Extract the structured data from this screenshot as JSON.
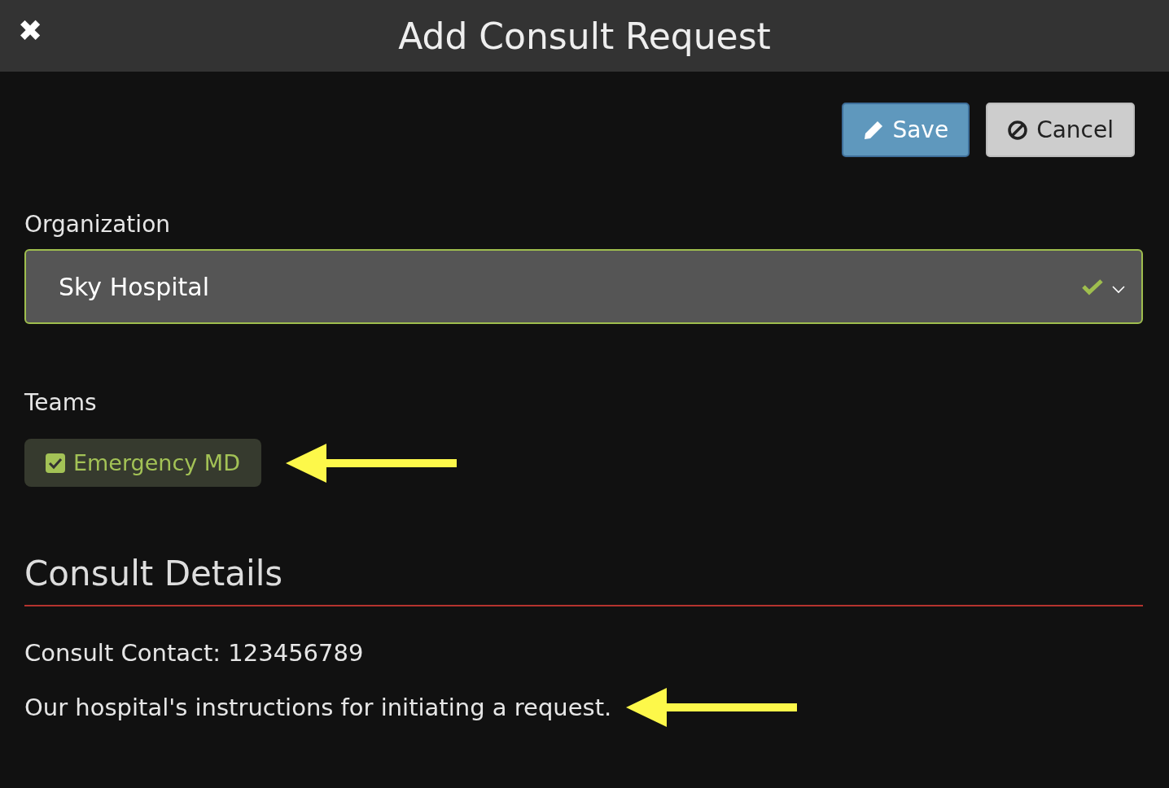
{
  "window": {
    "title": "Add Consult Request",
    "close": "✖"
  },
  "buttons": [
    {
      "label": "Save",
      "kind": "primary"
    },
    {
      "label": "Cancel",
      "kind": "secondary"
    }
  ],
  "organization": {
    "label": "Organization",
    "value": "Sky Hospital",
    "valid": true
  },
  "teams": {
    "label": "Teams",
    "items": [
      {
        "label": "Emergency MD",
        "checked": true,
        "pointed": true
      }
    ]
  },
  "details": {
    "heading": "Consult Details",
    "contact": "Consult Contact: 123456789",
    "instructions": "Our hospital's instructions for initiating a request.",
    "instructions_pointed": true
  }
}
